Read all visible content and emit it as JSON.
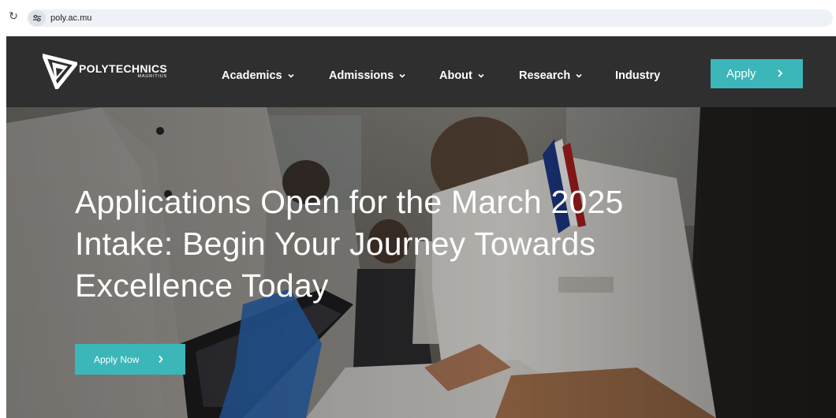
{
  "browser": {
    "url": "poly.ac.mu",
    "icons": [
      "reload-icon",
      "site-info-icon"
    ]
  },
  "header": {
    "logo": {
      "name": "POLYTECHNICS",
      "sub": "MAURITIUS"
    },
    "nav": [
      {
        "label": "Academics",
        "has_dropdown": true
      },
      {
        "label": "Admissions",
        "has_dropdown": true
      },
      {
        "label": "About",
        "has_dropdown": true
      },
      {
        "label": "Research",
        "has_dropdown": true
      },
      {
        "label": "Industry",
        "has_dropdown": false
      }
    ],
    "apply_label": "Apply"
  },
  "hero": {
    "title_lines": [
      "Applications Open for the March 2025",
      "Intake: Begin Your Journey Towards",
      "Excellence Today"
    ],
    "cta_label": "Apply Now"
  },
  "colors": {
    "header_bg": "#2f2f2f",
    "accent": "#3bb6b9",
    "text_light": "#ffffff"
  }
}
